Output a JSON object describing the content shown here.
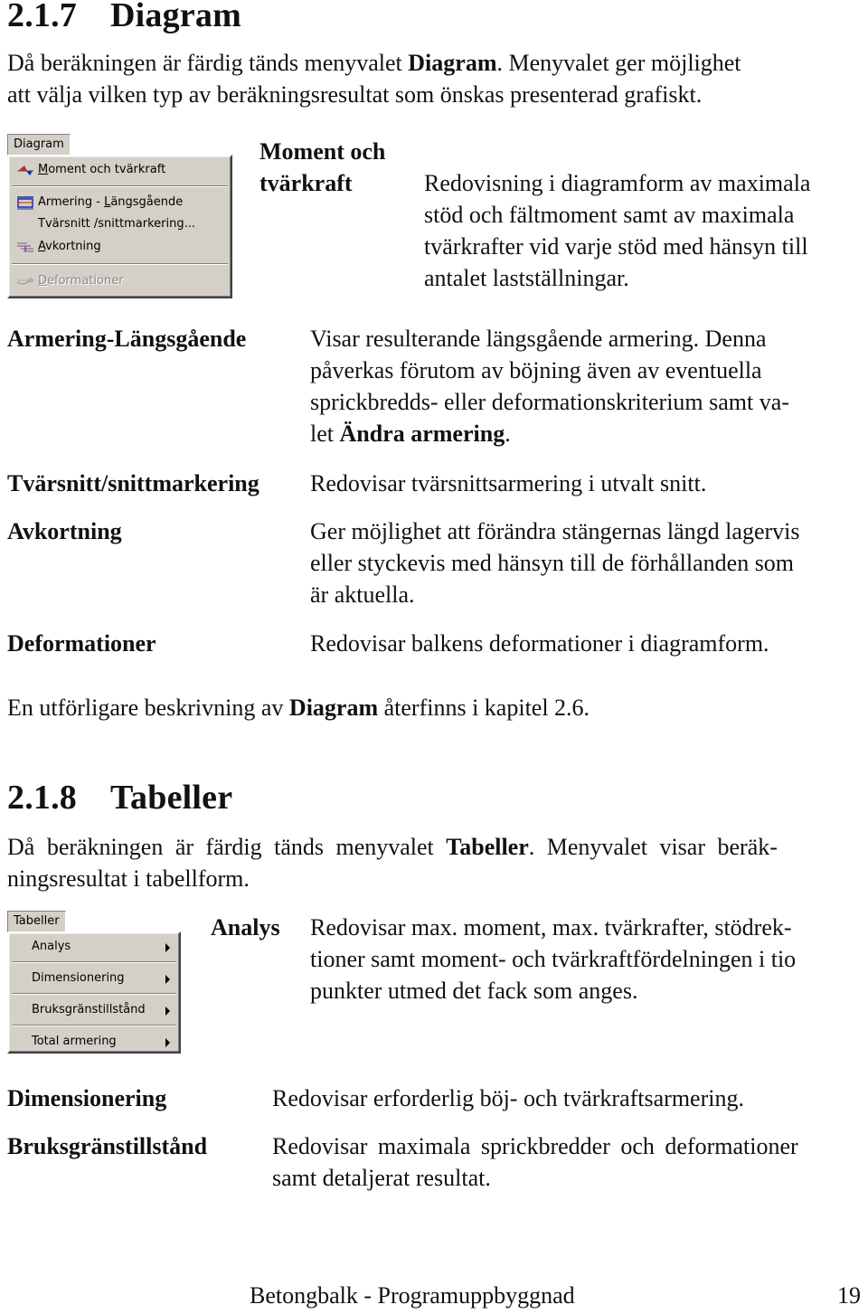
{
  "section_217": {
    "number": "2.1.7",
    "title": "Diagram",
    "intro_pre": "Då beräkningen är färdig tänds menyvalet ",
    "intro_bold": "Diagram",
    "intro_line1_post": ". Menyvalet ger möjlighet",
    "intro_line2": "att välja vilken typ av beräkningsresultat som önskas presenterad grafiskt.",
    "menu": {
      "title": "Diagram",
      "items": [
        {
          "label_pre": "",
          "mnemonic": "M",
          "label_post": "oment och tvärkraft",
          "icon": "moment-chart-icon",
          "enabled": true
        },
        {
          "label_pre": "Armering - ",
          "mnemonic": "L",
          "label_post": "ängsgående",
          "icon": "rebar-icon",
          "enabled": true
        },
        {
          "label_pre": "Tvärsnitt /snittmarkering...",
          "mnemonic": "",
          "label_post": "",
          "icon": "",
          "enabled": true
        },
        {
          "label_pre": "",
          "mnemonic": "A",
          "label_post": "vkortning",
          "icon": "curtailment-icon",
          "enabled": true
        },
        {
          "label_pre": "",
          "mnemonic": "D",
          "label_post": "eformationer",
          "icon": "deformation-icon",
          "enabled": false
        }
      ]
    },
    "definitions": [
      {
        "term_line1": "Moment och",
        "term_line2": "tvärkraft",
        "desc_lines": [
          "Redovisning i diagramform av maximala",
          "stöd och fältmoment samt av maximala",
          "tvärkrafter vid varje stöd med hänsyn till",
          "antalet lastställningar."
        ]
      },
      {
        "term": "Armering-Längsgående",
        "desc_lines": [
          "Visar resulterande längsgående armering. Denna",
          "påverkas förutom av böjning även av eventuella",
          "sprickbredds- eller deformationskriterium samt va-"
        ],
        "desc_last_pre": "let ",
        "desc_last_bold": "Ändra armering",
        "desc_last_post": "."
      },
      {
        "term": "Tvärsnitt/snittmarkering",
        "desc_lines": [
          "Redovisar tvärsnittsarmering i utvalt snitt."
        ]
      },
      {
        "term": "Avkortning",
        "desc_lines": [
          "Ger möjlighet att förändra stängernas längd lagervis",
          "eller styckevis med hänsyn till de förhållanden som",
          "är aktuella."
        ]
      },
      {
        "term": "Deformationer",
        "desc_lines": [
          "Redovisar balkens deformationer i diagramform."
        ]
      }
    ],
    "outro_pre": "En utförligare beskrivning av ",
    "outro_bold": "Diagram",
    "outro_post": " återfinns i kapitel 2.6."
  },
  "section_218": {
    "number": "2.1.8",
    "title": "Tabeller",
    "intro_pre": "Då beräkningen är färdig tänds menyvalet ",
    "intro_bold": "Tabeller",
    "intro_line1_post": ". Menyvalet visar beräk-",
    "intro_line2": "ningsresultat i tabellform.",
    "menu": {
      "title": "Tabeller",
      "items": [
        {
          "label": "Analys",
          "submenu": true
        },
        {
          "label": "Dimensionering",
          "submenu": true
        },
        {
          "label": "Bruksgränstillstånd",
          "submenu": true
        },
        {
          "label": "Total armering",
          "submenu": true
        }
      ]
    },
    "definitions": [
      {
        "term": "Analys",
        "desc_lines": [
          "Redovisar max. moment, max. tvärkrafter, stödrek-",
          "tioner samt moment- och tvärkraftfördelningen i tio",
          "punkter utmed det fack som anges."
        ]
      },
      {
        "term": "Dimensionering",
        "desc_lines": [
          "Redovisar erforderlig böj- och tvärkraftsarmering."
        ]
      },
      {
        "term": "Bruksgränstillstånd",
        "desc_lines": [
          "Redovisar maximala sprickbredder och deformationer",
          "samt detaljerat resultat."
        ]
      }
    ]
  },
  "footer": {
    "title": "Betongbalk - Programuppbyggnad",
    "page_number": "19"
  },
  "colors": {
    "menu_face": "#d4d0c8",
    "icon_red": "#d42020",
    "icon_blue": "#1a2fa8",
    "disabled_text": "#8a8a8a"
  }
}
